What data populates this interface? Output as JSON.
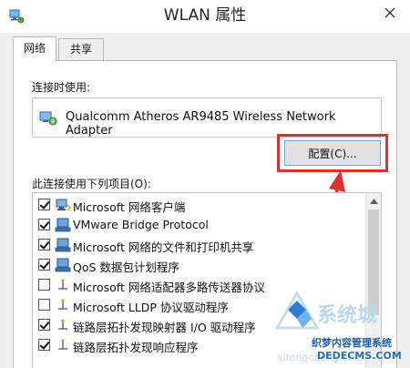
{
  "window": {
    "title": "WLAN 属性"
  },
  "tabs": [
    {
      "label": "网络",
      "active": true
    },
    {
      "label": "共享",
      "active": false
    }
  ],
  "connect": {
    "label": "连接时使用:",
    "adapter_name": "Qualcomm Atheros AR9485 Wireless Network Adapter",
    "adapter_icon": "network-adapter-icon"
  },
  "config_button": {
    "label": "配置(C)..."
  },
  "items": {
    "label": "此连接使用下列项目(O):",
    "rows": [
      {
        "label": "Microsoft 网络客户端",
        "checked": true,
        "icon": "network-client-icon"
      },
      {
        "label": "VMware Bridge Protocol",
        "checked": true,
        "icon": "network-service-icon"
      },
      {
        "label": "Microsoft 网络的文件和打印机共享",
        "checked": true,
        "icon": "network-service-icon"
      },
      {
        "label": "QoS 数据包计划程序",
        "checked": true,
        "icon": "network-service-icon"
      },
      {
        "label": "Microsoft 网络适配器多路传送器协议",
        "checked": false,
        "icon": "protocol-icon"
      },
      {
        "label": "Microsoft LLDP 协议驱动程序",
        "checked": false,
        "icon": "protocol-icon"
      },
      {
        "label": "链路层拓扑发现映射器 I/O 驱动程序",
        "checked": true,
        "icon": "protocol-icon"
      },
      {
        "label": "链路层拓扑发现响应程序",
        "checked": true,
        "icon": "protocol-icon"
      }
    ]
  },
  "watermark": {
    "brand": "系统城",
    "subtitle": "织梦内容管理系统",
    "url_left": "xitongcheng.com",
    "url_right": "DEDECMS.COM"
  },
  "colors": {
    "highlight": "#e03030",
    "arrow": "#e03030",
    "selection_border": "#7a9fd4"
  }
}
